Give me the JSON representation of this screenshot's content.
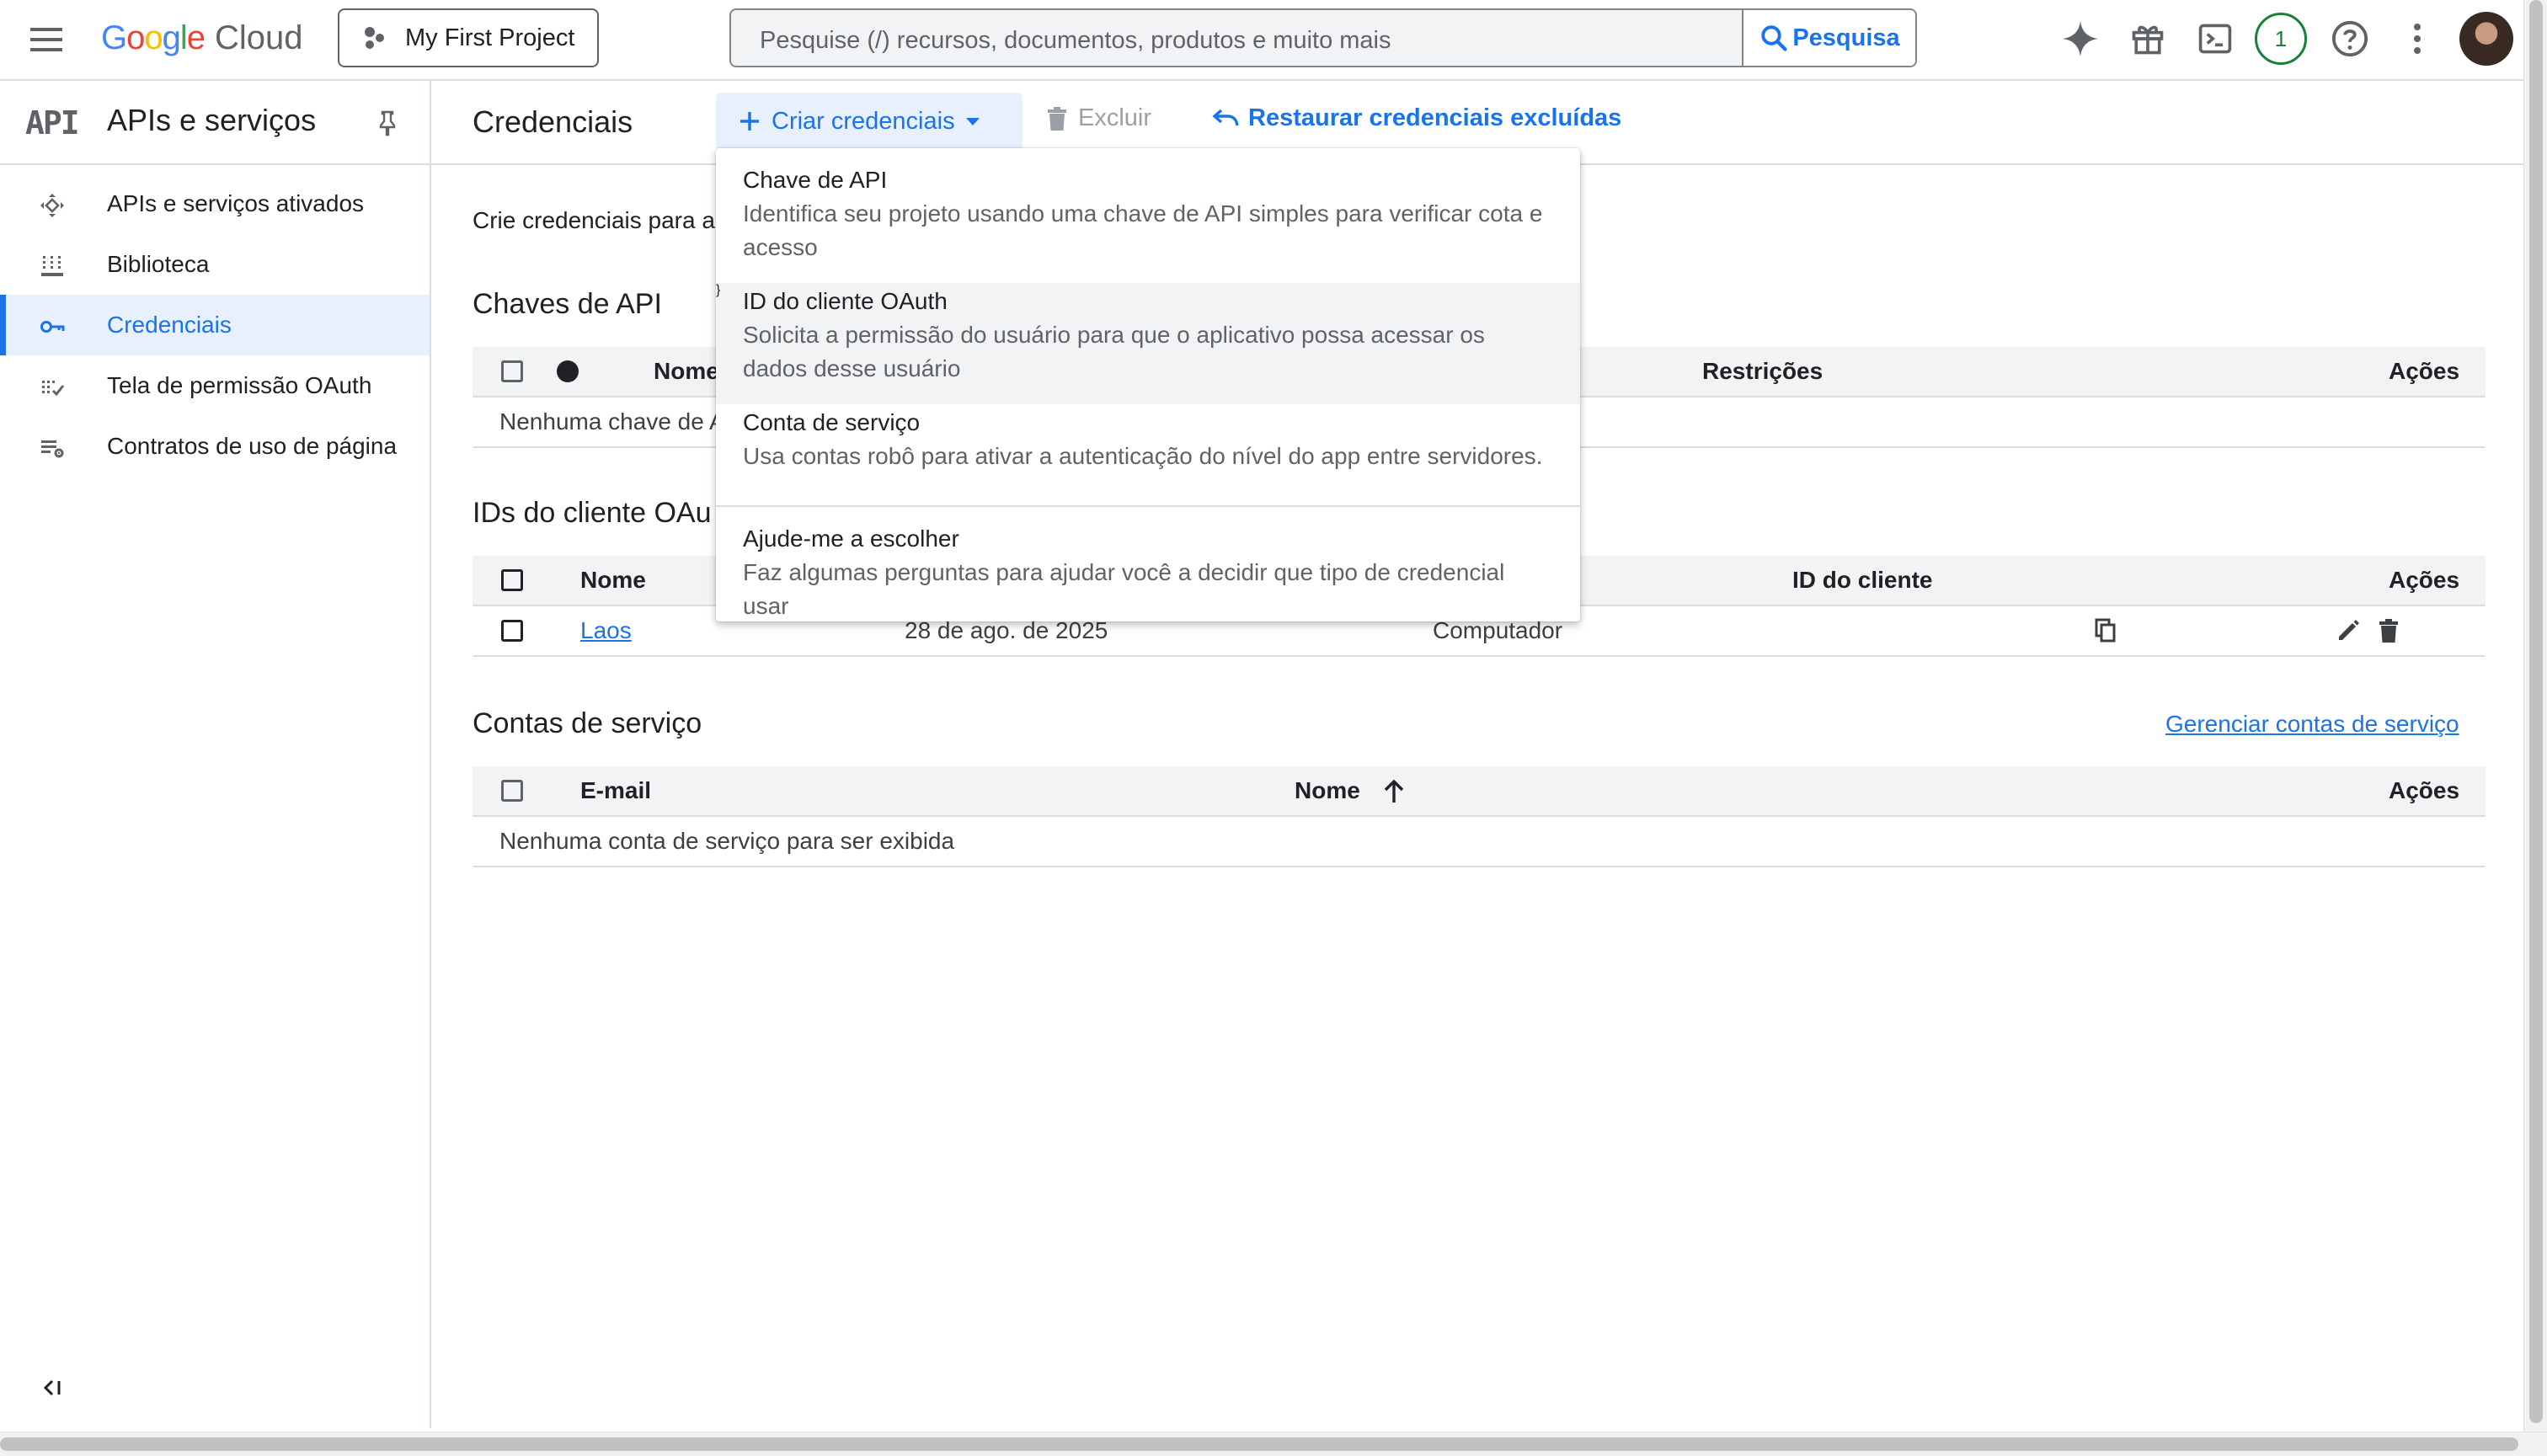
{
  "topbar": {
    "logo_google": "Google",
    "logo_cloud": "Cloud",
    "project_name": "My First Project",
    "search_placeholder": "Pesquise (/) recursos, documentos, produtos e muito mais",
    "search_button": "Pesquisa",
    "notification_count": "1",
    "google_colors": [
      "#4285F4",
      "#EA4335",
      "#FBBC05",
      "#4285F4",
      "#34A853",
      "#EA4335"
    ]
  },
  "sidebar": {
    "api_logo": "API",
    "title": "APIs e serviços",
    "items": [
      {
        "label": "APIs e serviços ativados",
        "icon": "diamond-arrows-icon",
        "active": false
      },
      {
        "label": "Biblioteca",
        "icon": "library-icon",
        "active": false
      },
      {
        "label": "Credenciais",
        "icon": "key-icon",
        "active": true
      },
      {
        "label": "Tela de permissão OAuth",
        "icon": "oauth-consent-icon",
        "active": false
      },
      {
        "label": "Contratos de uso de página",
        "icon": "settings-list-icon",
        "active": false
      }
    ]
  },
  "main": {
    "title": "Credenciais",
    "create_label": "Criar credenciais",
    "delete_label": "Excluir",
    "restore_label": "Restaurar credenciais excluídas",
    "intro": "Crie credenciais para ac",
    "api_keys": {
      "title": "Chaves de API",
      "headers": {
        "name": "Nome",
        "restrictions": "Restrições",
        "actions": "Ações"
      },
      "empty": "Nenhuma chave de A"
    },
    "oauth": {
      "title": "IDs do cliente OAu",
      "headers": {
        "name": "Nome",
        "client_id": "ID do cliente",
        "actions": "Ações"
      },
      "rows": [
        {
          "name": "Laos",
          "date": "28 de ago. de 2025",
          "type": "Computador"
        }
      ]
    },
    "service_accounts": {
      "title": "Contas de serviço",
      "manage_link": "Gerenciar contas de serviço",
      "headers": {
        "email": "E-mail",
        "name": "Nome",
        "actions": "Ações"
      },
      "empty": "Nenhuma conta de serviço para ser exibida"
    }
  },
  "dropdown": {
    "items": [
      {
        "title": "Chave de API",
        "desc1": "Identifica seu projeto usando uma chave de API simples para verificar cota e",
        "desc2": "acesso"
      },
      {
        "title": "ID do cliente OAuth",
        "desc1": "Solicita a permissão do usuário para que o aplicativo possa acessar os",
        "desc2": "dados desse usuário"
      },
      {
        "title": "Conta de serviço",
        "desc1": "Usa contas robô para ativar a autenticação do nível do app entre servidores."
      },
      {
        "title": "Ajude-me a escolher",
        "desc1": "Faz algumas perguntas para ajudar você a decidir que tipo de credencial usar"
      }
    ]
  },
  "colors": {
    "accent": "#1a73e8",
    "active_bg": "#e8f0fe",
    "success": "#188038"
  }
}
